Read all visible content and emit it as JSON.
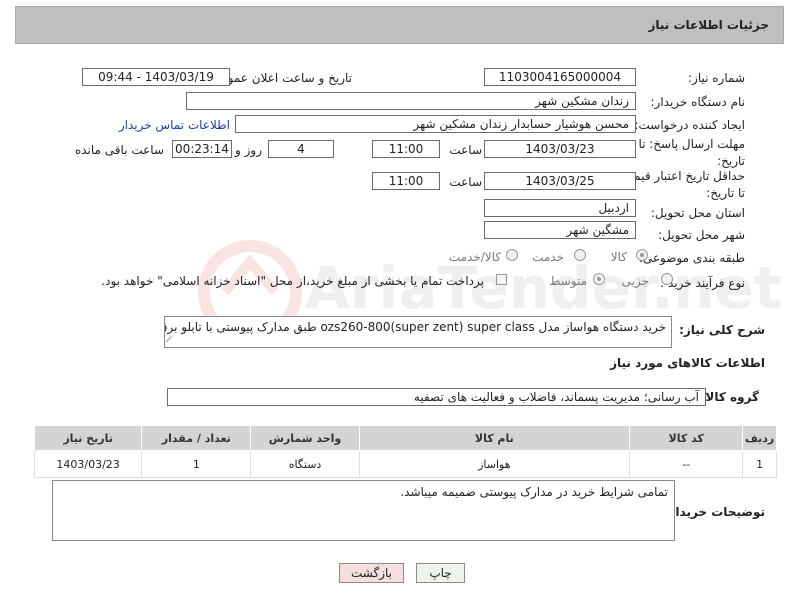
{
  "header": {
    "title": "جزئیات اطلاعات نیاز"
  },
  "fields": {
    "need_number_label": "شماره نیاز:",
    "need_number_value": "1103004165000004",
    "announce_label": "تاریخ و ساعت اعلان عمومی:",
    "announce_value": "1403/03/19 - 09:44",
    "buyer_org_label": "نام دستگاه خریدار:",
    "buyer_org_value": "زندان مشکین شهر",
    "requester_label": "ایجاد کننده درخواست:",
    "requester_value": "محسن هوشیار حسابدار زندان مشکین شهر",
    "contact_link": "اطلاعات تماس خریدار",
    "reply_deadline_label": "مهلت ارسال پاسخ: تا تاریخ:",
    "reply_date": "1403/03/23",
    "time_word": "ساعت",
    "reply_time": "11:00",
    "days_value": "4",
    "days_and_label": "روز و",
    "remaining_time": "00:23:14",
    "remaining_label": "ساعت باقی مانده",
    "price_validity_label": "حداقل تاریخ اعتبار قیمت: تا تاریخ:",
    "price_date": "1403/03/25",
    "price_time": "11:00",
    "province_label": "استان محل تحویل:",
    "province_value": "اردبیل",
    "city_label": "شهر محل تحویل:",
    "city_value": "مشگین شهر",
    "category_label": "طبقه بندی موضوعی:",
    "category_options": [
      "کالا",
      "خدمت",
      "کالا/خدمت"
    ],
    "category_selected": "کالا",
    "process_label": "نوع فرآیند خرید :",
    "process_options": [
      "جزیی",
      "متوسط"
    ],
    "process_selected": "متوسط",
    "payment_note": "پرداخت تمام یا بخشی از مبلغ خرید،از محل \"اسناد خزانه اسلامی\" خواهد بود.",
    "summary_label": "شرح کلی نیاز:",
    "summary_value": "خرید دستگاه هواساز مدل ozs260-800(super zent) super class طبق مدارک پیوستی با تابلو برق مکانیکال"
  },
  "goods_section": {
    "title": "اطلاعات کالاهای مورد نیاز",
    "group_label": "گروه کالا:",
    "group_value": "آب رسانی؛ مدیریت پسماند، فاضلاب و فعالیت های تصفیه",
    "columns": [
      "ردیف",
      "کد کالا",
      "نام کالا",
      "واحد شمارش",
      "تعداد / مقدار",
      "تاریخ نیاز"
    ],
    "rows": [
      {
        "row": "1",
        "code": "--",
        "name": "هواساز",
        "unit": "دستگاه",
        "qty": "1",
        "date": "1403/03/23"
      }
    ]
  },
  "buyer_notes": {
    "label": "توضیحات خریدار:",
    "value": "تمامی شرایط خرید در مدارک پیوستی ضمیمه میباشد."
  },
  "buttons": {
    "print": "چاپ",
    "back": "بازگشت"
  },
  "watermark": "AriaTender.net",
  "colors": {
    "header_bg": "#bfbfbf",
    "link": "#1a3fb0",
    "back_btn": "#f6dede",
    "print_btn": "#eef4ea"
  }
}
